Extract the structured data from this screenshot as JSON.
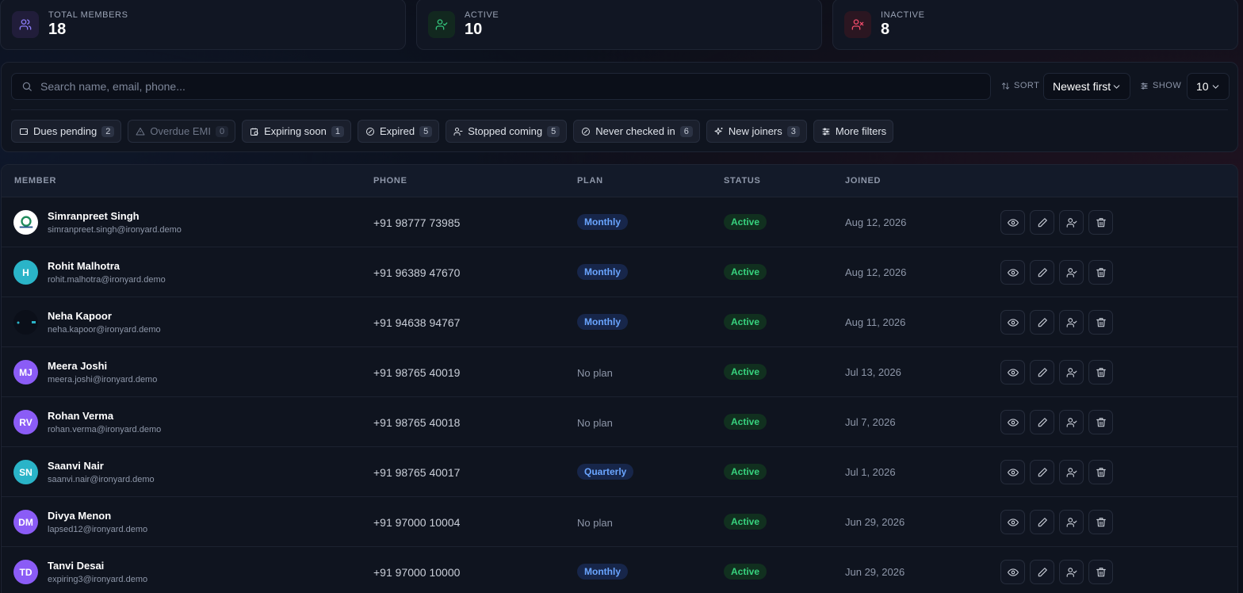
{
  "stats": [
    {
      "label": "TOTAL MEMBERS",
      "value": "18",
      "icon": "users-icon",
      "tone": "purple"
    },
    {
      "label": "ACTIVE",
      "value": "10",
      "icon": "user-check-icon",
      "tone": "green"
    },
    {
      "label": "INACTIVE",
      "value": "8",
      "icon": "user-x-icon",
      "tone": "red"
    }
  ],
  "filters": {
    "search_placeholder": "Search name, email, phone...",
    "sort_label": "SORT",
    "sort_value": "Newest first",
    "show_label": "SHOW",
    "show_value": "10",
    "chips": [
      {
        "label": "Dues pending",
        "count": "2",
        "icon": "wallet-icon"
      },
      {
        "label": "Overdue EMI",
        "count": "0",
        "icon": "alert-triangle-icon"
      },
      {
        "label": "Expiring soon",
        "count": "1",
        "icon": "calendar-clock-icon"
      },
      {
        "label": "Expired",
        "count": "5",
        "icon": "circle-slash-icon"
      },
      {
        "label": "Stopped coming",
        "count": "5",
        "icon": "user-minus-icon"
      },
      {
        "label": "Never checked in",
        "count": "6",
        "icon": "circle-slash-icon"
      },
      {
        "label": "New joiners",
        "count": "3",
        "icon": "sparkles-icon"
      },
      {
        "label": "More filters",
        "icon": "sliders-icon"
      }
    ]
  },
  "table": {
    "headers": {
      "member": "MEMBER",
      "phone": "PHONE",
      "plan": "PLAN",
      "status": "STATUS",
      "joined": "JOINED"
    },
    "rows": [
      {
        "name": "Simranpreet Singh",
        "email": "simranpreet.singh@ironyard.demo",
        "phone": "+91 98777 73985",
        "plan": "Monthly",
        "status": "Active",
        "joined": "Aug 12, 2026",
        "avatar": "",
        "avatar_color": "#ffffff"
      },
      {
        "name": "Rohit Malhotra",
        "email": "rohit.malhotra@ironyard.demo",
        "phone": "+91 96389 47670",
        "plan": "Monthly",
        "status": "Active",
        "joined": "Aug 12, 2026",
        "avatar": "H",
        "avatar_color": "#2ab4c8"
      },
      {
        "name": "Neha Kapoor",
        "email": "neha.kapoor@ironyard.demo",
        "phone": "+91 94638 94767",
        "plan": "Monthly",
        "status": "Active",
        "joined": "Aug 11, 2026",
        "avatar": "",
        "avatar_color": "#0b0f19"
      },
      {
        "name": "Meera Joshi",
        "email": "meera.joshi@ironyard.demo",
        "phone": "+91 98765 40019",
        "plan": "No plan",
        "status": "Active",
        "joined": "Jul 13, 2026",
        "avatar": "MJ",
        "avatar_color": "#8b5cf6"
      },
      {
        "name": "Rohan Verma",
        "email": "rohan.verma@ironyard.demo",
        "phone": "+91 98765 40018",
        "plan": "No plan",
        "status": "Active",
        "joined": "Jul 7, 2026",
        "avatar": "RV",
        "avatar_color": "#8b5cf6"
      },
      {
        "name": "Saanvi Nair",
        "email": "saanvi.nair@ironyard.demo",
        "phone": "+91 98765 40017",
        "plan": "Quarterly",
        "status": "Active",
        "joined": "Jul 1, 2026",
        "avatar": "SN",
        "avatar_color": "#2ab4c8"
      },
      {
        "name": "Divya Menon",
        "email": "lapsed12@ironyard.demo",
        "phone": "+91 97000 10004",
        "plan": "No plan",
        "status": "Active",
        "joined": "Jun 29, 2026",
        "avatar": "DM",
        "avatar_color": "#8b5cf6"
      },
      {
        "name": "Tanvi Desai",
        "email": "expiring3@ironyard.demo",
        "phone": "+91 97000 10000",
        "plan": "Monthly",
        "status": "Active",
        "joined": "Jun 29, 2026",
        "avatar": "TD",
        "avatar_color": "#8b5cf6"
      }
    ],
    "row_actions": [
      "eye-icon",
      "pencil-icon",
      "user-check-icon",
      "trash-icon"
    ]
  },
  "colors": {
    "accent": "#6aa5ff",
    "active": "#37d27e",
    "inactive": "#ef4b6b"
  }
}
